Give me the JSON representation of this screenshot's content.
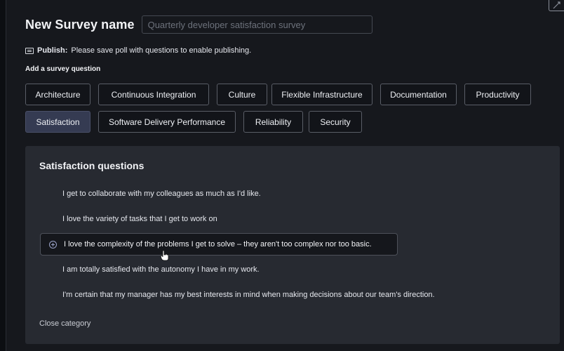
{
  "header": {
    "title": "New Survey name",
    "name_placeholder": "Quarterly developer satisfaction survey",
    "name_value": ""
  },
  "publish": {
    "label": "Publish:",
    "message": "Please save poll with questions to enable publishing."
  },
  "add_question_label": "Add a survey question",
  "categories": [
    {
      "label": "Architecture",
      "active": false
    },
    {
      "label": "Continuous Integration",
      "active": false
    },
    {
      "label": "Culture",
      "active": false
    },
    {
      "label": "Flexible Infrastructure",
      "active": false
    },
    {
      "label": "Documentation",
      "active": false
    },
    {
      "label": "Productivity",
      "active": false
    },
    {
      "label": "Satisfaction",
      "active": true
    },
    {
      "label": "Software Delivery Performance",
      "active": false
    },
    {
      "label": "Reliability",
      "active": false
    },
    {
      "label": "Security",
      "active": false
    }
  ],
  "panel": {
    "title": "Satisfaction questions",
    "questions": [
      "I get to collaborate with my colleagues as much as I'd like.",
      "I love the variety of tasks that I get to work on",
      "I love the complexity of the problems I get to solve – they aren't too complex nor too basic.",
      "I am totally satisfied with the autonomy I have in my work.",
      "I'm certain that my manager has my best interests in mind when making decisions about our team's direction."
    ],
    "close_label": "Close category"
  },
  "colors": {
    "background": "#16181d",
    "panel": "#272a31",
    "active_chip": "#353b52",
    "accent_icon": "#9aa2c8"
  },
  "icons": {
    "publish": "publish-card-icon",
    "add_question": "plus-circle-icon",
    "corner": "external-edit-icon"
  }
}
